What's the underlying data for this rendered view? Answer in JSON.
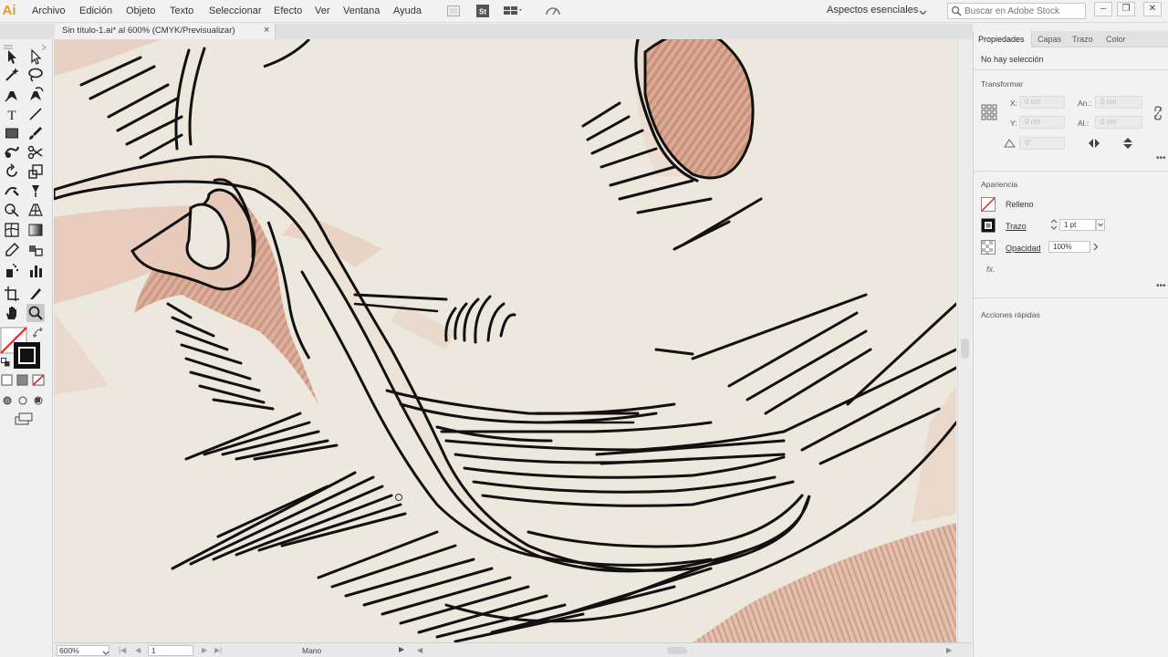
{
  "app": {
    "logo_text": "Ai",
    "brand_color": "#e89a2c"
  },
  "menu": {
    "items": [
      "Archivo",
      "Edición",
      "Objeto",
      "Texto",
      "Seleccionar",
      "Efecto",
      "Ver",
      "Ventana",
      "Ayuda"
    ],
    "icons": [
      "bridge-icon",
      "stock-icon",
      "arrange-documents-icon",
      "gpu-performance-icon"
    ]
  },
  "workspace": {
    "label": "Aspectos esenciales"
  },
  "stock_search": {
    "placeholder": "Buscar en Adobe Stock"
  },
  "window_controls": {
    "minimize": "–",
    "restore": "❐",
    "close": "✕"
  },
  "document_tab": {
    "title": "Sin título-1.ai* al 600% (CMYK/Previsualizar)",
    "close": "×"
  },
  "status_bar": {
    "zoom": "600%",
    "artboard": "1",
    "current_tool": "Mano",
    "more": "▶"
  },
  "panel": {
    "tabs": [
      "Propiedades",
      "Capas",
      "Trazo",
      "Color"
    ],
    "active_tab": "Propiedades",
    "selection_status": "No hay selección",
    "transform": {
      "heading": "Transformar",
      "x_label": "X:",
      "x_value": "0 cm",
      "y_label": "Y:",
      "y_value": "0 cm",
      "width_label": "An.:",
      "width_value": "0 cm",
      "height_label": "Al.:",
      "height_value": "0 cm",
      "angle_value": "0°"
    },
    "appearance": {
      "heading": "Apariencia",
      "fill_label": "Relleno",
      "stroke_label": "Trazo",
      "stroke_value": "1 pt",
      "opacity_label": "Opacidad",
      "opacity_value": "100%",
      "fx_label": "fx."
    },
    "quick_actions": {
      "heading": "Acciones rápidas"
    },
    "more": "•••"
  },
  "colors": {
    "canvas_paper": "#ede8dd",
    "artwork_tint": "#d8a48e",
    "stroke": "#111111"
  }
}
